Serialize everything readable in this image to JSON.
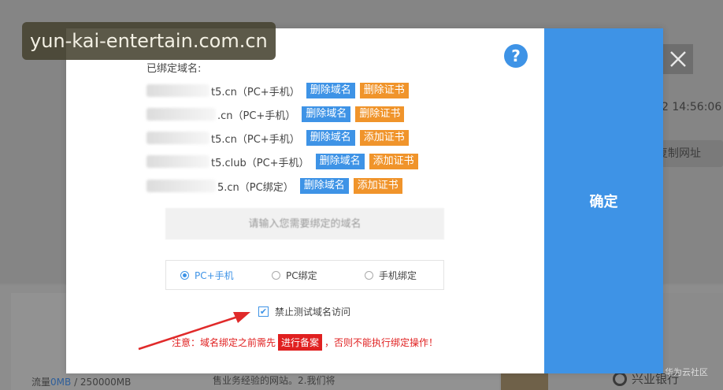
{
  "background": {
    "timestamp": "2 14:56:06",
    "copy_button": "复制网址",
    "traffic_prefix": "流量",
    "traffic_used": "0MB",
    "traffic_total": " / 250000MB",
    "bottom_text": "售业务经验的网站。2.我们将",
    "partner_logo": "兴业银行",
    "corner_watermark": "华为云社区"
  },
  "modal": {
    "bound_domains_label": "已绑定域名:",
    "domains": [
      {
        "text": "t5.cn（PC+手机）",
        "actions": [
          {
            "label": "删除域名",
            "color": "blue"
          },
          {
            "label": "删除证书",
            "color": "orange"
          }
        ]
      },
      {
        "text": ".cn（PC+手机）",
        "actions": [
          {
            "label": "删除域名",
            "color": "blue"
          },
          {
            "label": "删除证书",
            "color": "orange"
          }
        ]
      },
      {
        "text": "t5.cn（PC+手机）",
        "actions": [
          {
            "label": "删除域名",
            "color": "blue"
          },
          {
            "label": "添加证书",
            "color": "orange"
          }
        ]
      },
      {
        "text": "t5.club（PC+手机）",
        "actions": [
          {
            "label": "删除域名",
            "color": "blue"
          },
          {
            "label": "添加证书",
            "color": "orange"
          }
        ]
      },
      {
        "text": "5.cn（PC绑定）",
        "actions": [
          {
            "label": "删除域名",
            "color": "blue"
          },
          {
            "label": "添加证书",
            "color": "orange"
          }
        ]
      }
    ],
    "input_placeholder": "请输入您需要绑定的域名",
    "bind_modes": [
      {
        "label": "PC+手机",
        "selected": true
      },
      {
        "label": "PC绑定",
        "selected": false
      },
      {
        "label": "手机绑定",
        "selected": false
      }
    ],
    "disable_test_domain_label": "禁止测试域名访问",
    "disable_test_domain_checked": true,
    "notice_prefix": "注意：域名绑定之前需先",
    "notice_button": "进行备案",
    "notice_suffix": "，否则不能执行绑定操作！",
    "confirm_label": "确定",
    "help_icon": "?"
  },
  "watermark_text": "yun-kai-entertain.com.cn",
  "colors": {
    "accent_blue": "#3e93e6",
    "accent_orange": "#f0942b",
    "warning_red": "#e02020"
  }
}
